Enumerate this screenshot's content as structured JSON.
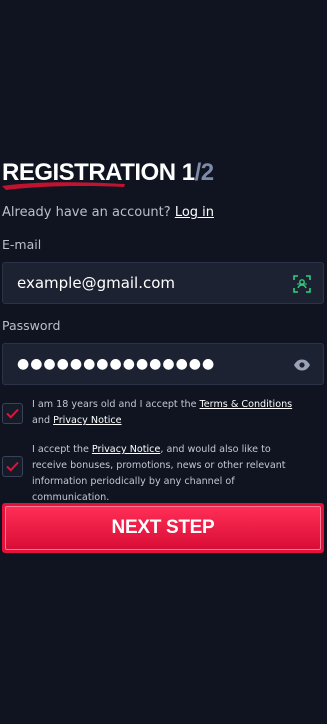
{
  "registration": {
    "title": "REGISTRATION",
    "step_current": "1",
    "step_separator": "/",
    "step_total": "2",
    "have_account_text": "Already have an account?",
    "login_link": "Log in",
    "email": {
      "label": "E-mail",
      "value": "example@gmail.com",
      "icon": "id-scan-icon"
    },
    "password": {
      "label": "Password",
      "value": "●●●●●●●●●●●●●●●",
      "icon": "eye-icon"
    },
    "consent_age": {
      "checked": true,
      "text_before": "I am 18 years old and I accept the ",
      "terms_link": "Terms & Conditions",
      "text_middle": " and ",
      "privacy_link": "Privacy Notice"
    },
    "consent_marketing": {
      "checked": true,
      "text_before": "I accept the ",
      "privacy_link": "Privacy Notice",
      "text_after": ", and would also like to receive bonuses, promotions, news or other relevant information periodically by any channel of communication."
    },
    "next_button_label": "NEXT STEP"
  },
  "colors": {
    "background": "#0f1420",
    "input_background": "#1c2232",
    "accent": "#e3123b",
    "icon_green": "#2fcf7b",
    "step_gray": "#7d8aa8"
  }
}
